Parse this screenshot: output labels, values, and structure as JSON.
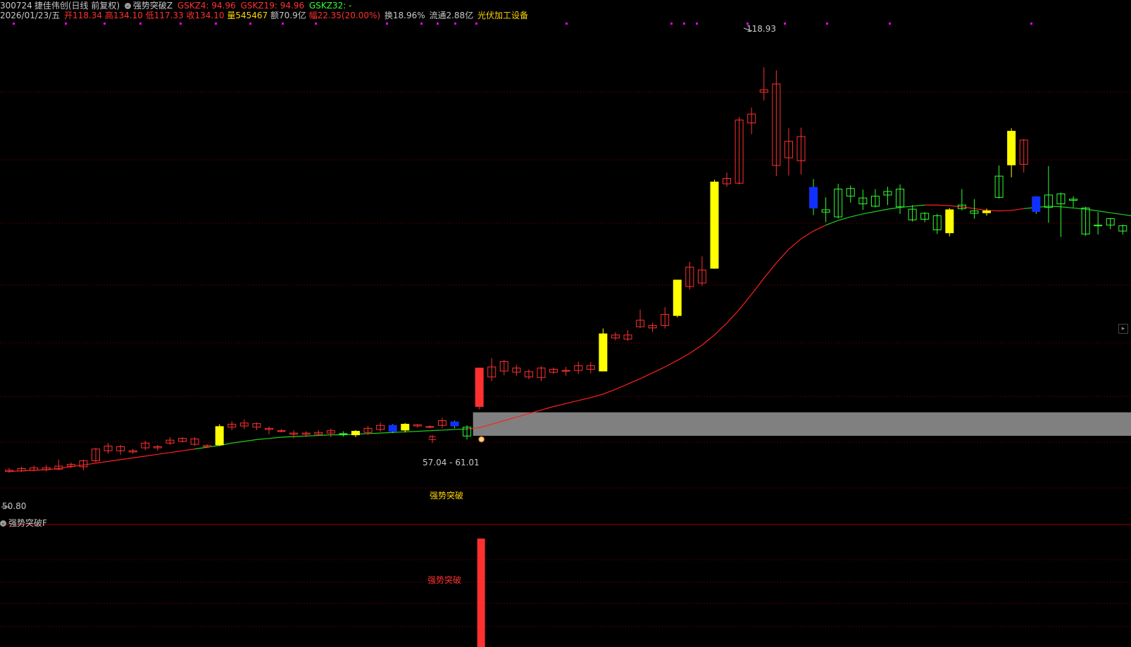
{
  "header": {
    "code": "300724",
    "name": "捷佳伟创",
    "mode": "(日线 前复权)",
    "indicator": "强势突破Z",
    "gskz4": "GSKZ4: 94.96",
    "gskz19": "GSKZ19: 94.96",
    "gskz32": "GSKZ32: -",
    "date": "2026/01/23/五",
    "open": "开118.34",
    "high": "高134.10",
    "low": "低117.33",
    "close": "收134.10",
    "volume": "量545467",
    "amount": "额70.9亿",
    "change": "幅22.35(20.00%)",
    "turnover": "换18.96%",
    "float": "流通2.88亿",
    "sector": "光伏加工设备"
  },
  "subpanel": {
    "title": "强势突破F",
    "signal_label": "强势突破"
  },
  "annotations": {
    "zone_label": "57.04 - 61.01",
    "bull_label": "牛",
    "strong_label": "强势突破",
    "high_mark": "118.93",
    "low_mark": "50.80"
  },
  "icons": {
    "indicator_toggle": "chevron-down-icon",
    "panel_collapse": "arrow-right-icon"
  },
  "colors": {
    "up": "#ff3030",
    "down": "#30ff30",
    "yellow_signal": "#ffff00",
    "blue_signal": "#1030ff",
    "ma_up": "#ff2020",
    "ma_down": "#20d020",
    "grid": "#8b0000",
    "zone": "#808080",
    "sector": "#ffd700"
  },
  "chart_data": {
    "type": "candlestick",
    "price_range": [
      45,
      127
    ],
    "zone": [
      57.04,
      61.01
    ],
    "candles": [
      {
        "o": 51.0,
        "c": 51.2,
        "h": 51.6,
        "l": 50.8,
        "k": "r"
      },
      {
        "o": 51.1,
        "c": 51.5,
        "h": 51.8,
        "l": 50.9,
        "k": "r"
      },
      {
        "o": 51.2,
        "c": 51.6,
        "h": 52.0,
        "l": 51.0,
        "k": "r"
      },
      {
        "o": 51.3,
        "c": 51.6,
        "h": 52.1,
        "l": 51.0,
        "k": "r"
      },
      {
        "o": 51.4,
        "c": 51.9,
        "h": 53.0,
        "l": 51.2,
        "k": "r"
      },
      {
        "o": 51.9,
        "c": 52.2,
        "h": 52.5,
        "l": 51.6,
        "k": "r"
      },
      {
        "o": 51.8,
        "c": 52.8,
        "h": 53.0,
        "l": 51.2,
        "k": "r"
      },
      {
        "o": 52.8,
        "c": 54.8,
        "h": 55.0,
        "l": 52.5,
        "k": "r"
      },
      {
        "o": 54.5,
        "c": 55.3,
        "h": 55.8,
        "l": 54.0,
        "k": "r"
      },
      {
        "o": 54.5,
        "c": 55.2,
        "h": 55.5,
        "l": 53.8,
        "k": "r"
      },
      {
        "o": 54.3,
        "c": 54.5,
        "h": 54.8,
        "l": 54.0,
        "k": "r"
      },
      {
        "o": 55.0,
        "c": 55.8,
        "h": 56.2,
        "l": 54.6,
        "k": "r"
      },
      {
        "o": 55.0,
        "c": 55.2,
        "h": 55.5,
        "l": 54.5,
        "k": "r"
      },
      {
        "o": 55.8,
        "c": 56.3,
        "h": 56.8,
        "l": 55.5,
        "k": "r"
      },
      {
        "o": 56.1,
        "c": 56.6,
        "h": 56.8,
        "l": 55.9,
        "k": "r"
      },
      {
        "o": 56.5,
        "c": 55.6,
        "h": 56.8,
        "l": 55.3,
        "k": "r"
      },
      {
        "o": 55.2,
        "c": 55.4,
        "h": 55.6,
        "l": 55.0,
        "k": "r"
      },
      {
        "o": 55.5,
        "c": 58.6,
        "h": 59.0,
        "l": 55.3,
        "k": "y"
      },
      {
        "o": 58.5,
        "c": 59.0,
        "h": 59.5,
        "l": 58.0,
        "k": "r"
      },
      {
        "o": 58.7,
        "c": 59.2,
        "h": 59.8,
        "l": 58.2,
        "k": "r"
      },
      {
        "o": 58.5,
        "c": 59.1,
        "h": 59.3,
        "l": 58.0,
        "k": "r"
      },
      {
        "o": 58.1,
        "c": 58.3,
        "h": 58.6,
        "l": 57.3,
        "k": "r"
      },
      {
        "o": 57.8,
        "c": 57.9,
        "h": 58.2,
        "l": 57.6,
        "k": "r"
      },
      {
        "o": 57.3,
        "c": 57.5,
        "h": 58.0,
        "l": 56.6,
        "k": "r"
      },
      {
        "o": 57.3,
        "c": 57.5,
        "h": 57.8,
        "l": 56.8,
        "k": "r"
      },
      {
        "o": 57.3,
        "c": 57.6,
        "h": 58.0,
        "l": 57.0,
        "k": "r"
      },
      {
        "o": 57.5,
        "c": 57.9,
        "h": 58.3,
        "l": 56.8,
        "k": "r"
      },
      {
        "o": 57.3,
        "c": 57.4,
        "h": 57.8,
        "l": 56.9,
        "k": "g"
      },
      {
        "o": 57.2,
        "c": 57.8,
        "h": 58.0,
        "l": 56.8,
        "k": "y"
      },
      {
        "o": 57.6,
        "c": 58.3,
        "h": 58.7,
        "l": 57.2,
        "k": "r"
      },
      {
        "o": 58.1,
        "c": 58.8,
        "h": 59.3,
        "l": 57.7,
        "k": "r"
      },
      {
        "o": 58.8,
        "c": 57.8,
        "h": 59.0,
        "l": 57.5,
        "k": "b"
      },
      {
        "o": 58.0,
        "c": 59.0,
        "h": 59.2,
        "l": 57.6,
        "k": "y"
      },
      {
        "o": 58.7,
        "c": 58.9,
        "h": 59.0,
        "l": 58.4,
        "k": "r"
      },
      {
        "o": 58.5,
        "c": 58.6,
        "h": 58.8,
        "l": 58.3,
        "k": "r"
      },
      {
        "o": 58.8,
        "c": 59.6,
        "h": 60.1,
        "l": 58.3,
        "k": "r"
      },
      {
        "o": 59.4,
        "c": 58.7,
        "h": 59.6,
        "l": 58.3,
        "k": "b"
      },
      {
        "o": 58.5,
        "c": 57.0,
        "h": 58.8,
        "l": 56.4,
        "k": "g"
      },
      {
        "o": 62.0,
        "c": 68.5,
        "h": 68.5,
        "l": 61.5,
        "k": "R"
      },
      {
        "o": 67.0,
        "c": 68.7,
        "h": 70.2,
        "l": 66.3,
        "k": "r"
      },
      {
        "o": 68.0,
        "c": 69.6,
        "h": 69.9,
        "l": 67.3,
        "k": "r"
      },
      {
        "o": 67.8,
        "c": 68.5,
        "h": 69.0,
        "l": 67.2,
        "k": "r"
      },
      {
        "o": 67.0,
        "c": 67.9,
        "h": 68.3,
        "l": 66.6,
        "k": "r"
      },
      {
        "o": 66.9,
        "c": 68.5,
        "h": 68.8,
        "l": 66.3,
        "k": "r"
      },
      {
        "o": 67.8,
        "c": 68.3,
        "h": 68.6,
        "l": 67.5,
        "k": "r"
      },
      {
        "o": 68.0,
        "c": 68.1,
        "h": 68.7,
        "l": 67.2,
        "k": "r"
      },
      {
        "o": 68.1,
        "c": 68.9,
        "h": 69.6,
        "l": 67.5,
        "k": "r"
      },
      {
        "o": 68.3,
        "c": 68.9,
        "h": 69.5,
        "l": 67.6,
        "k": "r"
      },
      {
        "o": 68.0,
        "c": 74.3,
        "h": 75.2,
        "l": 68.0,
        "k": "y"
      },
      {
        "o": 73.6,
        "c": 74.1,
        "h": 74.6,
        "l": 73.2,
        "k": "r"
      },
      {
        "o": 73.4,
        "c": 74.1,
        "h": 74.9,
        "l": 73.1,
        "k": "r"
      },
      {
        "o": 75.5,
        "c": 76.6,
        "h": 78.4,
        "l": 75.3,
        "k": "r"
      },
      {
        "o": 75.3,
        "c": 75.7,
        "h": 76.2,
        "l": 74.6,
        "k": "r"
      },
      {
        "o": 75.7,
        "c": 77.6,
        "h": 78.8,
        "l": 75.2,
        "k": "r"
      },
      {
        "o": 77.4,
        "c": 83.4,
        "h": 83.4,
        "l": 77.1,
        "k": "y"
      },
      {
        "o": 82.3,
        "c": 85.6,
        "h": 86.5,
        "l": 81.8,
        "k": "r"
      },
      {
        "o": 82.9,
        "c": 85.1,
        "h": 87.4,
        "l": 82.4,
        "k": "r"
      },
      {
        "o": 85.4,
        "c": 100.0,
        "h": 100.4,
        "l": 85.3,
        "k": "y"
      },
      {
        "o": 99.7,
        "c": 100.6,
        "h": 101.6,
        "l": 99.2,
        "k": "r"
      },
      {
        "o": 99.8,
        "c": 110.5,
        "h": 111.0,
        "l": 99.6,
        "k": "r"
      },
      {
        "o": 110.0,
        "c": 111.5,
        "h": 112.6,
        "l": 108.1,
        "k": "r"
      },
      {
        "o": 115.2,
        "c": 115.6,
        "h": 119.4,
        "l": 113.8,
        "k": "r"
      },
      {
        "o": 102.8,
        "c": 116.6,
        "h": 118.9,
        "l": 101.0,
        "k": "r"
      },
      {
        "o": 106.9,
        "c": 104.1,
        "h": 109.1,
        "l": 101.1,
        "k": "r"
      },
      {
        "o": 103.6,
        "c": 107.7,
        "h": 109.2,
        "l": 101.3,
        "k": "r"
      },
      {
        "o": 99.1,
        "c": 95.6,
        "h": 100.5,
        "l": 94.4,
        "k": "b"
      },
      {
        "o": 95.3,
        "c": 94.9,
        "h": 97.4,
        "l": 93.2,
        "k": "g"
      },
      {
        "o": 94.1,
        "c": 98.8,
        "h": 99.7,
        "l": 93.8,
        "k": "g"
      },
      {
        "o": 98.9,
        "c": 97.6,
        "h": 99.4,
        "l": 96.5,
        "k": "g"
      },
      {
        "o": 97.3,
        "c": 96.3,
        "h": 98.7,
        "l": 95.3,
        "k": "g"
      },
      {
        "o": 95.9,
        "c": 97.6,
        "h": 98.8,
        "l": 95.7,
        "k": "g"
      },
      {
        "o": 97.8,
        "c": 98.4,
        "h": 99.2,
        "l": 96.1,
        "k": "g"
      },
      {
        "o": 98.8,
        "c": 95.8,
        "h": 99.6,
        "l": 94.6,
        "k": "g"
      },
      {
        "o": 95.4,
        "c": 93.6,
        "h": 96.1,
        "l": 93.3,
        "k": "g"
      },
      {
        "o": 94.7,
        "c": 93.7,
        "h": 94.9,
        "l": 93.2,
        "k": "g"
      },
      {
        "o": 94.3,
        "c": 91.9,
        "h": 94.6,
        "l": 91.2,
        "k": "g"
      },
      {
        "o": 91.4,
        "c": 95.3,
        "h": 95.6,
        "l": 90.8,
        "k": "y"
      },
      {
        "o": 95.5,
        "c": 96.1,
        "h": 98.8,
        "l": 95.2,
        "k": "g"
      },
      {
        "o": 95.1,
        "c": 94.7,
        "h": 97.1,
        "l": 93.8,
        "k": "g"
      },
      {
        "o": 95.1,
        "c": 94.8,
        "h": 95.5,
        "l": 94.3,
        "k": "y"
      },
      {
        "o": 97.4,
        "c": 101.0,
        "h": 102.8,
        "l": 97.2,
        "k": "g"
      },
      {
        "o": 108.6,
        "c": 102.9,
        "h": 109.1,
        "l": 100.8,
        "k": "y"
      },
      {
        "o": 107.1,
        "c": 103.0,
        "h": 107.3,
        "l": 101.6,
        "k": "r"
      },
      {
        "o": 97.5,
        "c": 95.0,
        "h": 97.6,
        "l": 94.6,
        "k": "b"
      },
      {
        "o": 95.7,
        "c": 97.8,
        "h": 102.7,
        "l": 93.1,
        "k": "g"
      },
      {
        "o": 96.3,
        "c": 98.0,
        "h": 98.2,
        "l": 90.7,
        "k": "g"
      },
      {
        "o": 97.1,
        "c": 96.9,
        "h": 97.6,
        "l": 95.7,
        "k": "g"
      },
      {
        "o": 95.6,
        "c": 91.2,
        "h": 95.8,
        "l": 90.9,
        "k": "g"
      },
      {
        "o": 92.7,
        "c": 92.7,
        "h": 94.9,
        "l": 91.1,
        "k": "g"
      },
      {
        "o": 93.8,
        "c": 92.7,
        "h": 93.9,
        "l": 92.0,
        "k": "g"
      },
      {
        "o": 92.6,
        "c": 91.7,
        "h": 92.8,
        "l": 91.1,
        "k": "g"
      },
      {
        "o": 91.9,
        "c": 91.4,
        "h": 92.2,
        "l": 89.8,
        "k": "g"
      },
      {
        "o": 93.0,
        "c": 94.2,
        "h": 95.0,
        "l": 92.6,
        "k": "y"
      }
    ],
    "ma": [
      51.0,
      51.1,
      51.2,
      51.3,
      51.5,
      51.8,
      52.1,
      52.4,
      52.7,
      53.0,
      53.3,
      53.6,
      53.9,
      54.2,
      54.5,
      54.8,
      55.1,
      55.4,
      55.8,
      56.1,
      56.4,
      56.6,
      56.8,
      56.9,
      57.0,
      57.1,
      57.2,
      57.2,
      57.3,
      57.4,
      57.5,
      57.6,
      57.7,
      57.8,
      57.9,
      58.0,
      58.1,
      58.2,
      58.4,
      59.0,
      59.6,
      60.2,
      60.8,
      61.4,
      62.0,
      62.5,
      63.0,
      63.5,
      64.1,
      64.9,
      65.8,
      66.7,
      67.7,
      68.7,
      69.8,
      71.0,
      72.4,
      74.1,
      76.1,
      78.4,
      81.0,
      83.7,
      86.3,
      88.6,
      90.4,
      91.7,
      92.7,
      93.5,
      94.1,
      94.6,
      95.0,
      95.4,
      95.7,
      95.9,
      96.1,
      96.1,
      96.0,
      95.8,
      95.5,
      95.2,
      95.1,
      95.2,
      95.5,
      95.7,
      95.9,
      95.8,
      95.6,
      95.4,
      95.1,
      94.8,
      94.5,
      94.2,
      93.9
    ]
  }
}
